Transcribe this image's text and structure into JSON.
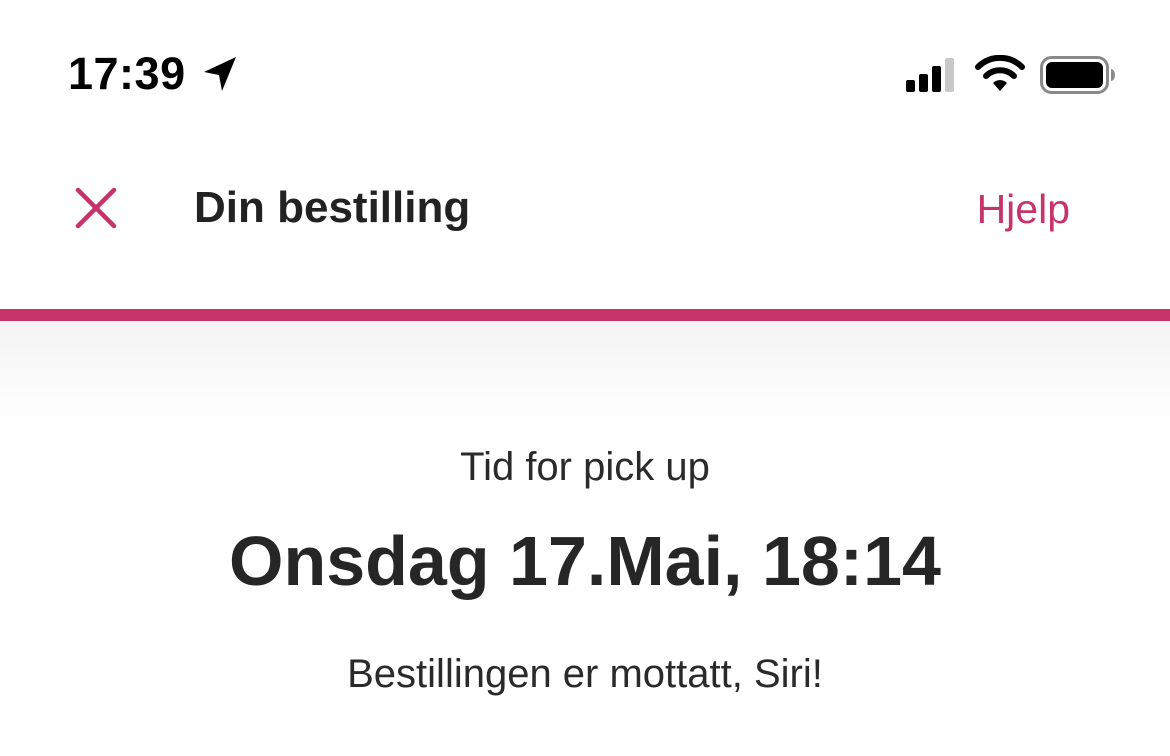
{
  "status_bar": {
    "time": "17:39",
    "location_icon": "location-arrow-icon",
    "signal_icon": "cellular-signal-icon",
    "wifi_icon": "wifi-icon",
    "battery_icon": "battery-icon"
  },
  "nav": {
    "close_icon": "close-icon",
    "title": "Din bestilling",
    "help_label": "Hjelp"
  },
  "order": {
    "pickup_label": "Tid for pick up",
    "pickup_time": "Onsdag 17.Mai, 18:14",
    "confirmation": "Bestillingen er mottatt, Siri!"
  },
  "colors": {
    "accent": "#c7336b",
    "text": "#222222",
    "background": "#ffffff"
  }
}
